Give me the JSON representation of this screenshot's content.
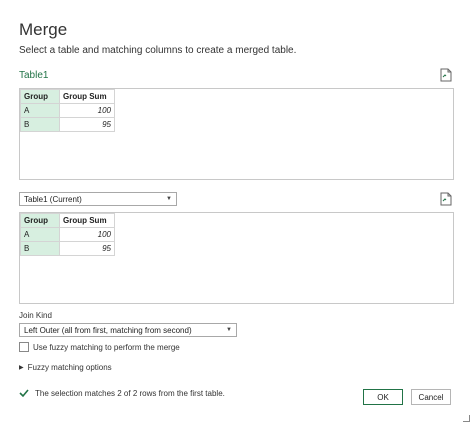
{
  "dialog": {
    "title": "Merge",
    "subtitle": "Select a table and matching columns to create a merged table."
  },
  "first_table": {
    "label": "Table1",
    "columns": [
      "Group",
      "Group Sum"
    ],
    "rows": [
      [
        "A",
        "100"
      ],
      [
        "B",
        "95"
      ]
    ]
  },
  "second_table": {
    "dropdown_value": "Table1 (Current)",
    "columns": [
      "Group",
      "Group Sum"
    ],
    "rows": [
      [
        "A",
        "100"
      ],
      [
        "B",
        "95"
      ]
    ]
  },
  "join": {
    "label": "Join Kind",
    "value": "Left Outer (all from first, matching from second)"
  },
  "fuzzy": {
    "checkbox_label": "Use fuzzy matching to perform the merge",
    "options_label": "Fuzzy matching options"
  },
  "status": {
    "message": "The selection matches 2 of 2 rows from the first table.",
    "color": "#217346"
  },
  "buttons": {
    "ok": "OK",
    "cancel": "Cancel"
  }
}
